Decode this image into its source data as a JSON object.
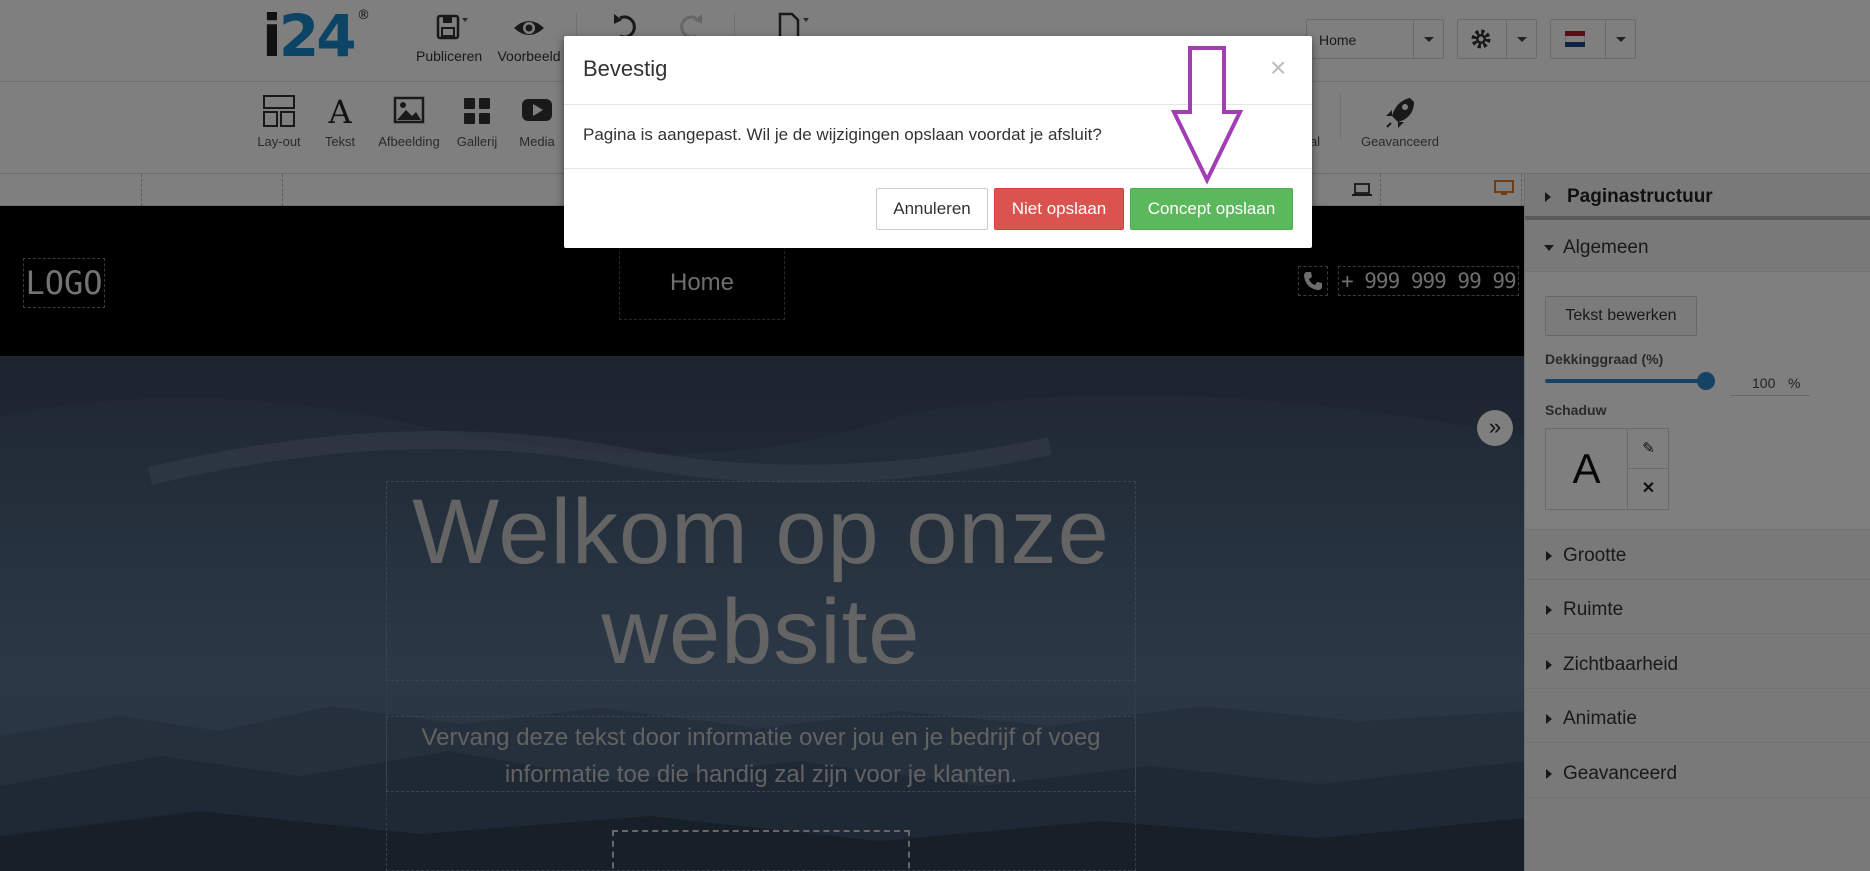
{
  "app": {
    "logo_main": "i24",
    "logo_reg": "®"
  },
  "topbar": {
    "publish_label": "Publiceren",
    "preview_label": "Voorbeeld",
    "page_select_value": "Home"
  },
  "toolbar": {
    "items": [
      "Lay-out",
      "Tekst",
      "Afbeelding",
      "Gallerij",
      "Media",
      "al",
      "Geavanceerd"
    ]
  },
  "site": {
    "logo": "LOGO",
    "nav_home": "Home",
    "phone": "+ 999 999 99 99",
    "hero_title": "Welkom op onze website",
    "hero_subtitle": "Vervang deze tekst door informatie over jou en je bedrijf of voeg informatie toe die handig zal zijn voor je klanten."
  },
  "panel": {
    "header": "Paginastructuur",
    "section_general": "Algemeen",
    "edit_text_button": "Tekst bewerken",
    "opacity_label": "Dekkinggraad (%)",
    "opacity_value": "100",
    "opacity_unit": "%",
    "opacity_fraction": 1.0,
    "shadow_label": "Schaduw",
    "shadow_preview": "A",
    "sections": [
      "Grootte",
      "Ruimte",
      "Zichtbaarheid",
      "Animatie",
      "Geavanceerd"
    ]
  },
  "modal": {
    "title": "Bevestig",
    "close": "×",
    "message": "Pagina is aangepast. Wil je de wijzigingen opslaan voordat je afsluit?",
    "cancel": "Annuleren",
    "dont_save": "Niet opslaan",
    "save_draft": "Concept opslaan"
  },
  "colors": {
    "brand_blue": "#1789c9",
    "danger": "#d9534f",
    "success": "#5cb85c",
    "arrow": "#a23eb4"
  }
}
